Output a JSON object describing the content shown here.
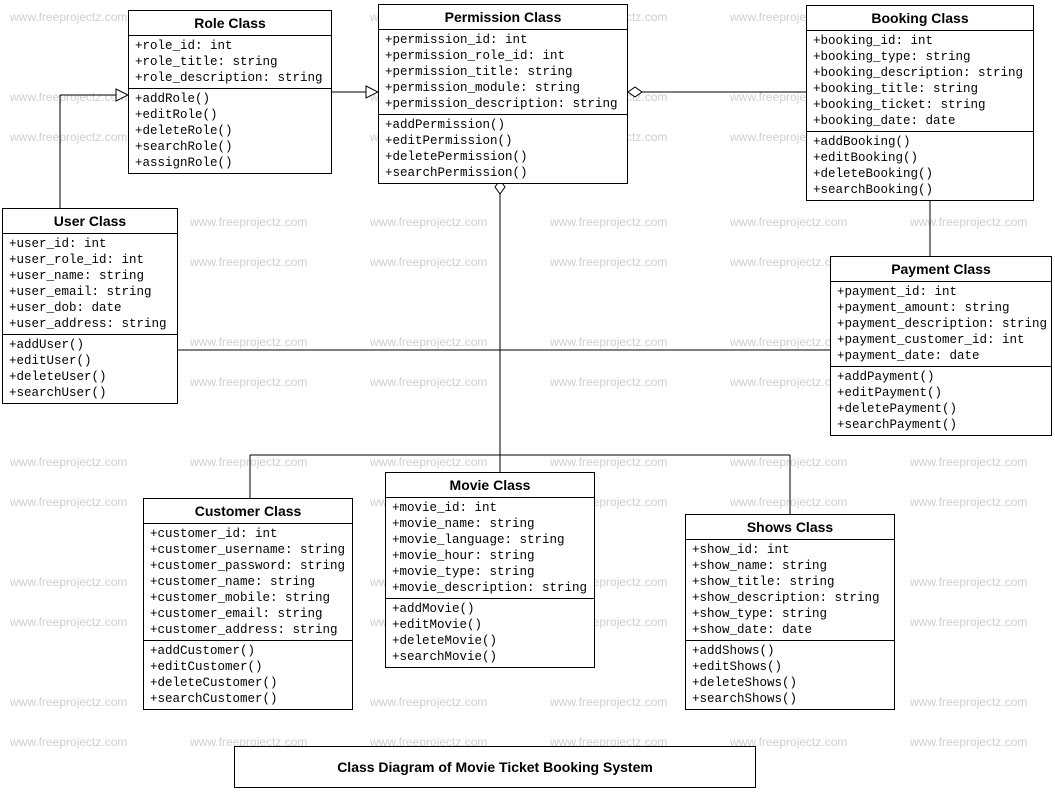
{
  "watermark_text": "www.freeprojectz.com",
  "diagram_title": "Class Diagram of Movie Ticket Booking System",
  "classes": {
    "role": {
      "title": "Role Class",
      "attrs": [
        "+role_id: int",
        "+role_title: string",
        "+role_description: string"
      ],
      "methods": [
        "+addRole()",
        "+editRole()",
        "+deleteRole()",
        "+searchRole()",
        "+assignRole()"
      ]
    },
    "permission": {
      "title": "Permission Class",
      "attrs": [
        "+permission_id: int",
        "+permission_role_id: int",
        "+permission_title: string",
        "+permission_module: string",
        "+permission_description: string"
      ],
      "methods": [
        "+addPermission()",
        "+editPermission()",
        "+deletePermission()",
        "+searchPermission()"
      ]
    },
    "booking": {
      "title": "Booking Class",
      "attrs": [
        "+booking_id: int",
        "+booking_type: string",
        "+booking_description: string",
        "+booking_title: string",
        "+booking_ticket: string",
        "+booking_date: date"
      ],
      "methods": [
        "+addBooking()",
        "+editBooking()",
        "+deleteBooking()",
        "+searchBooking()"
      ]
    },
    "user": {
      "title": "User Class",
      "attrs": [
        "+user_id: int",
        "+user_role_id: int",
        "+user_name: string",
        "+user_email: string",
        "+user_dob: date",
        "+user_address: string"
      ],
      "methods": [
        "+addUser()",
        "+editUser()",
        "+deleteUser()",
        "+searchUser()"
      ]
    },
    "payment": {
      "title": "Payment Class",
      "attrs": [
        "+payment_id: int",
        "+payment_amount: string",
        "+payment_description: string",
        "+payment_customer_id: int",
        "+payment_date: date"
      ],
      "methods": [
        "+addPayment()",
        "+editPayment()",
        "+deletePayment()",
        "+searchPayment()"
      ]
    },
    "customer": {
      "title": "Customer Class",
      "attrs": [
        "+customer_id: int",
        "+customer_username: string",
        "+customer_password: string",
        "+customer_name: string",
        "+customer_mobile: string",
        "+customer_email: string",
        "+customer_address: string"
      ],
      "methods": [
        "+addCustomer()",
        "+editCustomer()",
        "+deleteCustomer()",
        "+searchCustomer()"
      ]
    },
    "movie": {
      "title": "Movie  Class",
      "attrs": [
        "+movie_id: int",
        "+movie_name: string",
        "+movie_language: string",
        "+movie_hour: string",
        "+movie_type: string",
        "+movie_description: string"
      ],
      "methods": [
        "+addMovie()",
        "+editMovie()",
        "+deleteMovie()",
        "+searchMovie()"
      ]
    },
    "shows": {
      "title": "Shows Class",
      "attrs": [
        "+show_id: int",
        "+show_name: string",
        "+show_title: string",
        "+show_description: string",
        "+show_type: string",
        "+show_date: date"
      ],
      "methods": [
        "+addShows()",
        "+editShows()",
        "+deleteShows()",
        "+searchShows()"
      ]
    }
  }
}
